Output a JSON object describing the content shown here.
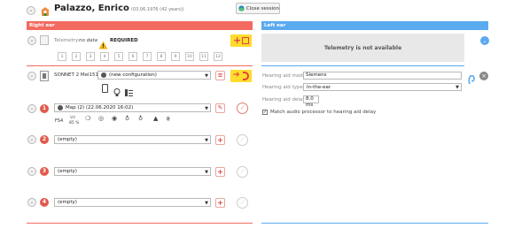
{
  "header": {
    "patient_name": "Palazzo, Enrico",
    "patient_dob": "(03.06.1976 (42 years))",
    "close_session": "Close session"
  },
  "right_ear": {
    "title": "Right ear",
    "telemetry_label": "Telemetry:",
    "telemetry_value": "no data",
    "required_label": "REQUIRED",
    "electrodes": [
      "1",
      "2",
      "3",
      "4",
      "5",
      "6",
      "7",
      "8",
      "9",
      "10",
      "11",
      "12"
    ],
    "device": "SONNET 2 Mel1510",
    "configuration": "(new configuration)",
    "programs": [
      {
        "number": "1",
        "value": "Map (2) (22.06.2020 16:02)",
        "active": true
      },
      {
        "number": "2",
        "value": "(empty)",
        "active": false
      },
      {
        "number": "3",
        "value": "(empty)",
        "active": false
      },
      {
        "number": "4",
        "value": "(empty)",
        "active": false
      }
    ],
    "fs4_label": "FS4",
    "vol_label": "Vol",
    "vol_value": "85 %"
  },
  "left_ear": {
    "title": "Left ear",
    "telemetry_unavailable": "Telemetry is not available",
    "hearing_aid_model_label": "Hearing aid model:",
    "hearing_aid_model_value": "Siemens",
    "hearing_aid_type_label": "Hearing aid type:",
    "hearing_aid_type_value": "In-the-ear",
    "hearing_aid_delay_label": "Hearing aid delay:",
    "hearing_aid_delay_value": "8.0 ms",
    "match_checkbox_label": "Match audio processor to hearing aid delay",
    "match_checked": true
  },
  "colors": {
    "right_accent": "#f26a60",
    "left_accent": "#5aaaf0",
    "warning_yellow": "#ffdc2e",
    "program_red": "#e25a4e"
  }
}
